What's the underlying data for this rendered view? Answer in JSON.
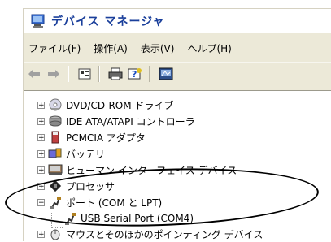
{
  "window": {
    "title": "デバイス マネージャ",
    "icon": "computer-monitor-icon"
  },
  "menu": [
    {
      "label": "ファイル(F)",
      "name": "menu-file"
    },
    {
      "label": "操作(A)",
      "name": "menu-action"
    },
    {
      "label": "表示(V)",
      "name": "menu-view"
    },
    {
      "label": "ヘルプ(H)",
      "name": "menu-help"
    }
  ],
  "toolbar": {
    "back_icon": "back-arrow-icon",
    "forward_icon": "forward-arrow-icon",
    "properties_icon": "properties-icon",
    "print_icon": "print-icon",
    "help_icon": "help-icon",
    "scan_icon": "scan-hardware-icon"
  },
  "tree": {
    "items": [
      {
        "label": "DVD/CD-ROM ドライブ",
        "expander": "+",
        "icon": "dvd-drive-icon"
      },
      {
        "label": "IDE ATA/ATAPI コントローラ",
        "expander": "+",
        "icon": "ide-controller-icon"
      },
      {
        "label": "PCMCIA アダプタ",
        "expander": "+",
        "icon": "pcmcia-icon"
      },
      {
        "label": "バッテリ",
        "expander": "+",
        "icon": "battery-icon"
      },
      {
        "label": "ヒューマン インターフェイス デバイス",
        "expander": "+",
        "icon": "hid-icon"
      },
      {
        "label": "プロセッサ",
        "expander": "+",
        "icon": "processor-icon"
      },
      {
        "label": "ポート (COM と LPT)",
        "expander": "−",
        "icon": "port-icon"
      },
      {
        "label": "USB Serial Port (COM4)",
        "expander": "",
        "icon": "port-icon"
      },
      {
        "label": "マウスとそのほかのポインティング デバイス",
        "expander": "+",
        "icon": "mouse-icon"
      }
    ]
  }
}
